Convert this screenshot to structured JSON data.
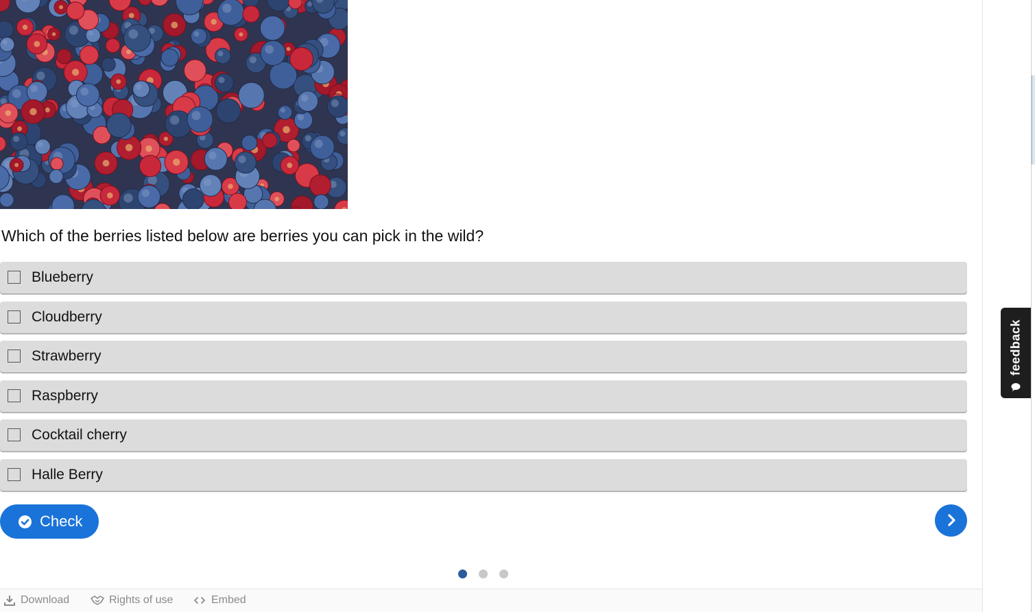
{
  "question": {
    "text": "Which of the berries listed below are berries you can pick in the wild?"
  },
  "options": [
    {
      "label": "Blueberry",
      "checked": false
    },
    {
      "label": "Cloudberry",
      "checked": false
    },
    {
      "label": "Strawberry",
      "checked": false
    },
    {
      "label": "Raspberry",
      "checked": false
    },
    {
      "label": "Cocktail cherry",
      "checked": false
    },
    {
      "label": "Halle Berry",
      "checked": false
    }
  ],
  "actions": {
    "check_label": "Check",
    "check_icon": "check-circle-icon",
    "next_icon": "chevron-right-icon"
  },
  "pager": {
    "total": 3,
    "current": 1
  },
  "footer": {
    "download_label": "Download",
    "rights_label": "Rights of use",
    "embed_label": "Embed"
  },
  "feedback": {
    "label": "feedback",
    "icon": "speech-bubble-icon"
  },
  "colors": {
    "accent": "#1a73d9",
    "option_bg": "#dcdcdc",
    "pager_active": "#2b5b9c",
    "pager_inactive": "#c8c8c8",
    "feedback_bg": "#1e1e1e"
  }
}
